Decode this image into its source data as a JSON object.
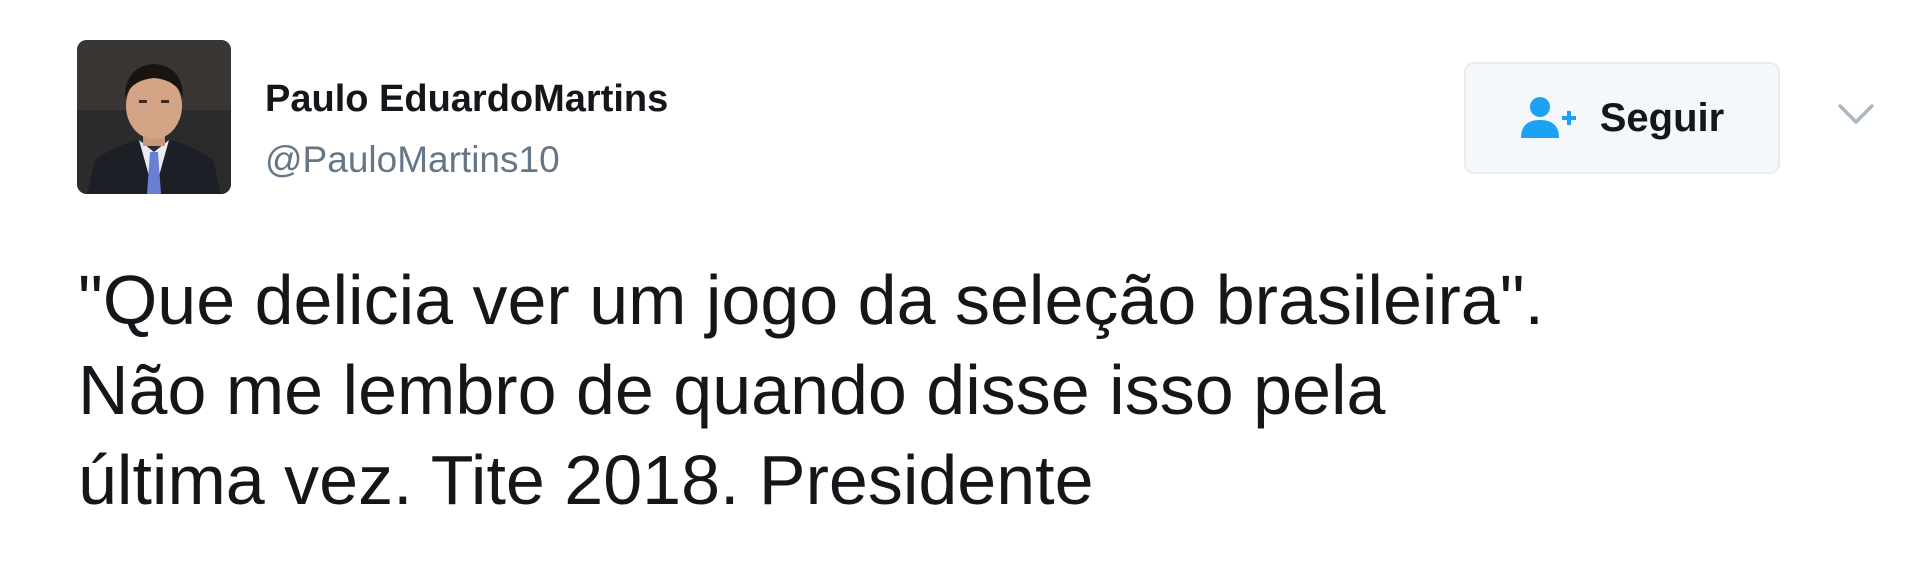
{
  "author": {
    "name": "Paulo EduardoMartins",
    "handle": "@PauloMartins10",
    "avatar_icon": "profile-photo"
  },
  "follow_button": {
    "label": "Seguir",
    "icon": "add-user-icon",
    "icon_color": "#1da1f2"
  },
  "menu": {
    "icon": "chevron-down-icon"
  },
  "tweet": {
    "lines": [
      "\"Que delicia ver um jogo da seleção brasileira\".",
      "Não me lembro de quando disse isso pela",
      "última vez. Tite 2018. Presidente"
    ]
  },
  "colors": {
    "text": "#14171a",
    "secondary_text": "#657786",
    "accent": "#1da1f2"
  }
}
